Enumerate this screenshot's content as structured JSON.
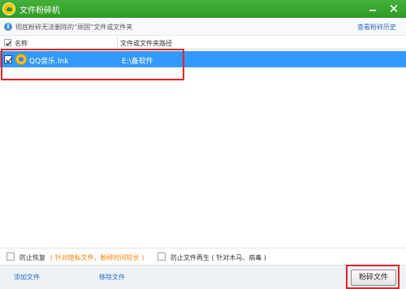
{
  "window": {
    "title": "文件粉碎机"
  },
  "infobar": {
    "text": "彻底粉碎无法删除的“顽固”文件或文件夹",
    "history_link": "查看粉碎历史"
  },
  "list": {
    "columns": [
      "名称",
      "文件或文件夹路径"
    ],
    "rows": [
      {
        "name": "QQ音乐.lnk",
        "path": "E:\\备软件",
        "checked": true,
        "selected": true
      }
    ]
  },
  "options": {
    "prevent_recover_label": "防止恢复",
    "prevent_recover_note": "( 针对隐私文件，粉碎时间较长 )",
    "prevent_regen_label": "防止文件再生 ( 针对木马、病毒 )"
  },
  "footer": {
    "add_label": "添加文件",
    "remove_label": "移除文件",
    "shred_label": "粉碎文件"
  },
  "colors": {
    "titlebar": "#3aa830",
    "selection": "#3399ff",
    "note": "#ff7e00",
    "link": "#2b6cc4",
    "highlight": "#e02424"
  }
}
